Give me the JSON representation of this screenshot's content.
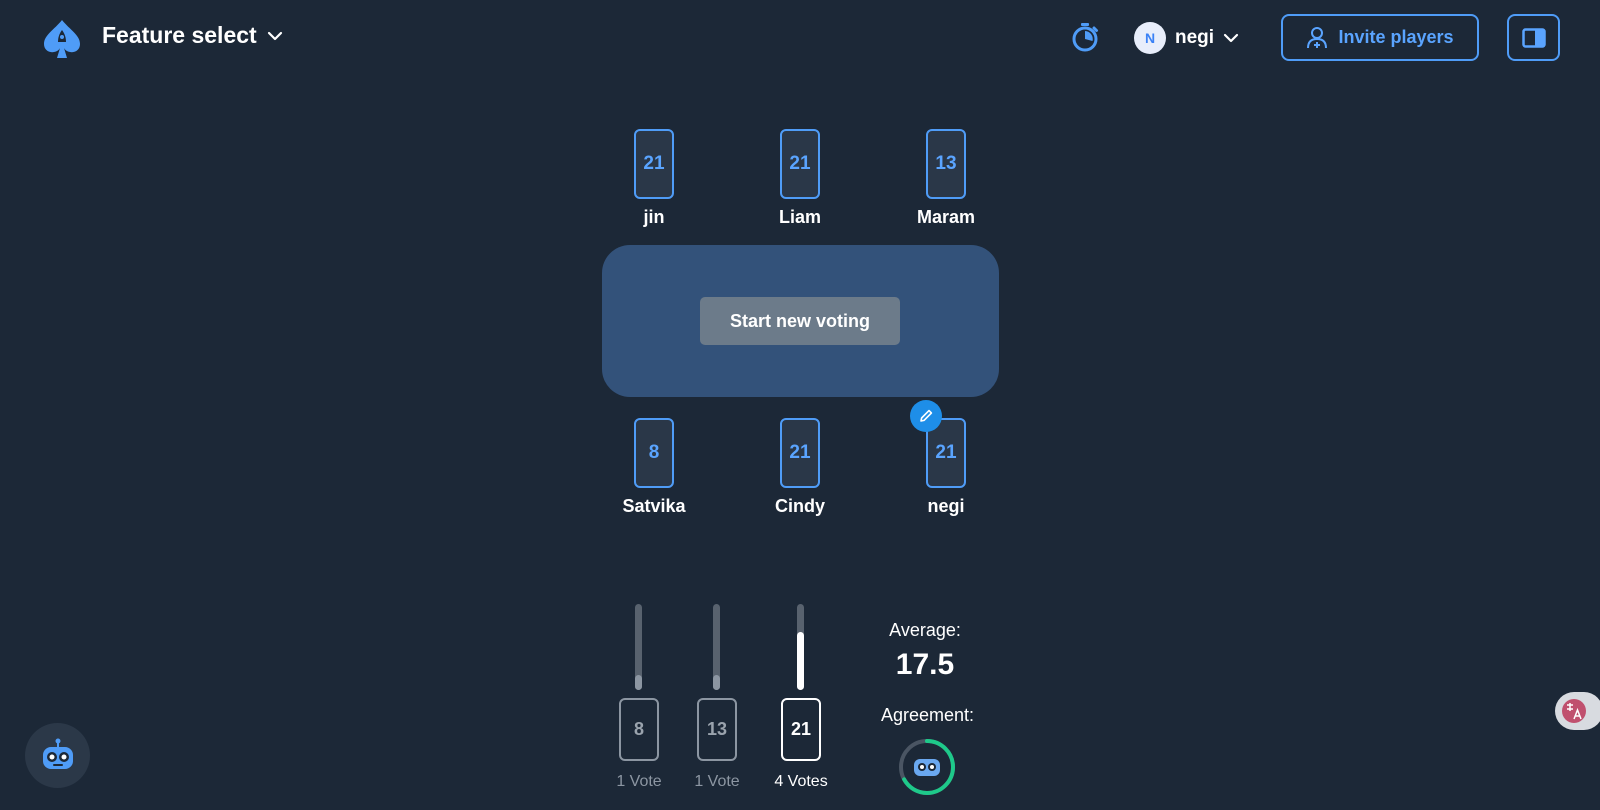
{
  "header": {
    "logo_icon": "spade-rocket-logo-icon",
    "game_title": "Feature select",
    "timer_icon": "stopwatch-icon",
    "user": {
      "initial": "N",
      "name": "negi"
    },
    "invite_label": "Invite players",
    "invite_icon": "add-user-icon",
    "sidebar_icon": "sidebar-toggle-icon"
  },
  "table": {
    "start_label": "Start new voting",
    "edit_icon": "pencil-icon"
  },
  "players_top": [
    {
      "name": "jin",
      "vote": "21"
    },
    {
      "name": "Liam",
      "vote": "21"
    },
    {
      "name": "Maram",
      "vote": "13"
    }
  ],
  "players_bottom": [
    {
      "name": "Satvika",
      "vote": "8"
    },
    {
      "name": "Cindy",
      "vote": "21"
    },
    {
      "name": "negi",
      "vote": "21"
    }
  ],
  "results": {
    "options": [
      {
        "card": "8",
        "votes_label": "1 Vote",
        "votes": 1
      },
      {
        "card": "13",
        "votes_label": "1 Vote",
        "votes": 1
      },
      {
        "card": "21",
        "votes_label": "4 Votes",
        "votes": 4
      }
    ],
    "average_label": "Average:",
    "average_value": "17.5",
    "agreement_label": "Agreement:",
    "agreement_fraction": 0.67,
    "agreement_icon": "robot-face-icon"
  },
  "floating": {
    "robot_icon": "robot-assistant-icon",
    "translate_icon": "translate-icon"
  },
  "colors": {
    "background": "#1c2837",
    "accent": "#4f9cf7",
    "table": "#33527a",
    "agreement": "#1ec98a"
  }
}
